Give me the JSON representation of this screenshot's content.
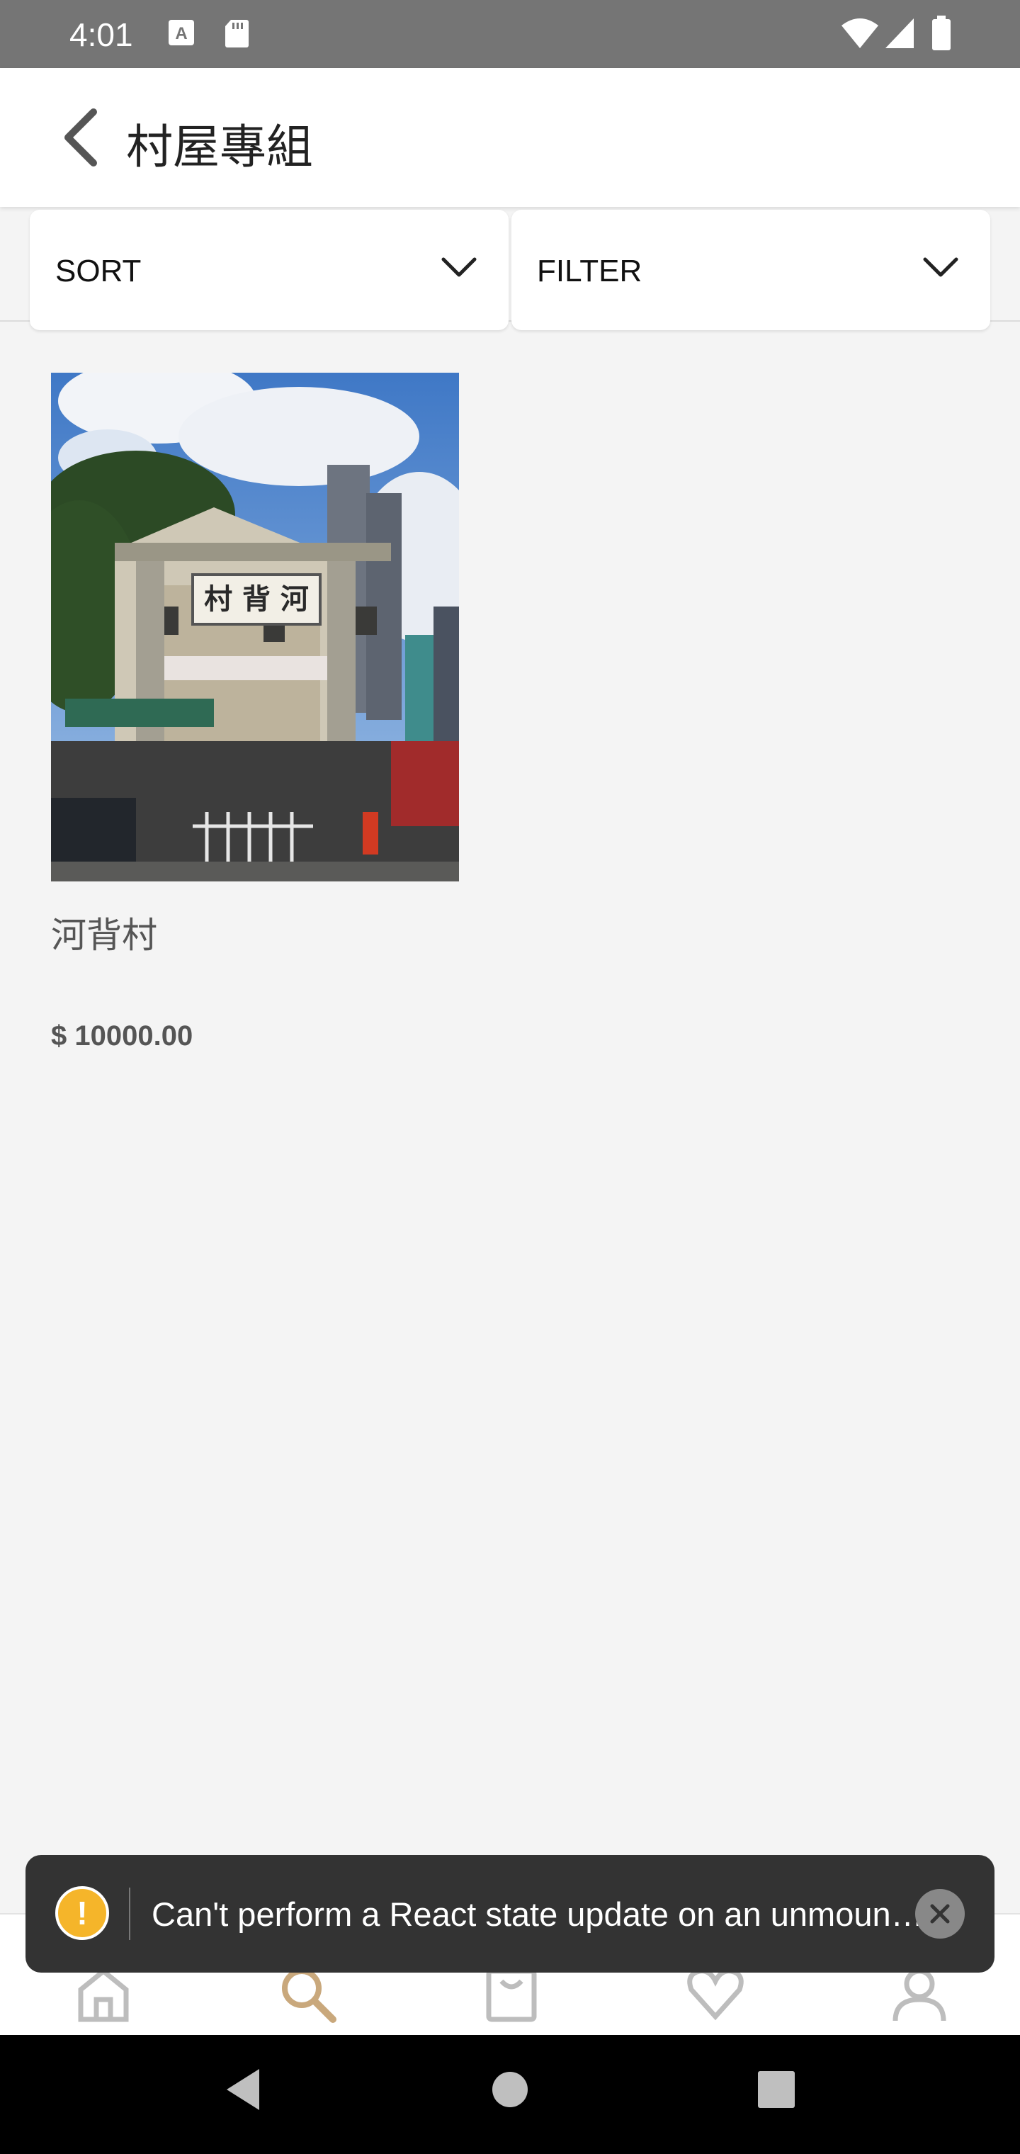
{
  "status_bar": {
    "time": "4:01",
    "icons": [
      "text-a-icon",
      "sd-card-icon",
      "wifi-icon",
      "cellular-signal-icon",
      "battery-icon"
    ]
  },
  "header": {
    "title": "村屋專組",
    "back_icon": "chevron-left-icon"
  },
  "toolbar": {
    "sort_label": "SORT",
    "filter_label": "FILTER",
    "dropdown_icon": "chevron-down-icon"
  },
  "products": [
    {
      "name": "河背村",
      "price": "$ 10000.00",
      "sign_text": "村 背 河"
    }
  ],
  "tab_bar": {
    "tabs": [
      {
        "icon": "home-icon",
        "active": false
      },
      {
        "icon": "search-icon",
        "active": true
      },
      {
        "icon": "bag-icon",
        "active": false
      },
      {
        "icon": "heart-icon",
        "active": false
      },
      {
        "icon": "person-icon",
        "active": false
      }
    ],
    "active_color": "#c9a87c",
    "inactive_color": "#bdbdbd"
  },
  "toast": {
    "message": "Can't perform a React state update on an unmounted component.",
    "warning_glyph": "!",
    "warning_color": "#f5b52a"
  },
  "system_nav": {
    "buttons": [
      "back-triangle-icon",
      "home-circle-icon",
      "recents-square-icon"
    ]
  }
}
